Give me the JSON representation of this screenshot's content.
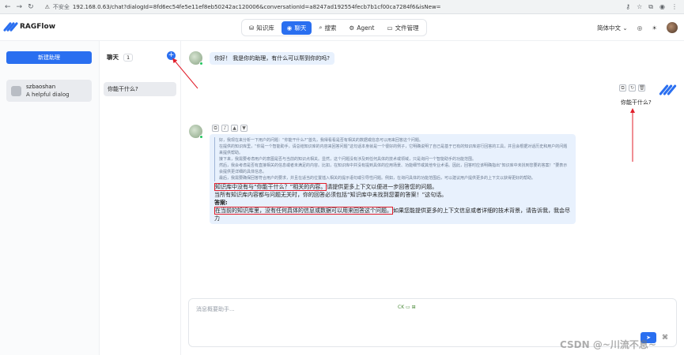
{
  "browser": {
    "insecure_label": "不安全",
    "url": "192.168.0.63/chat?dialogId=8fd6ec54fe5e11ef8eb50242ac120006&conversationId=a8247ad192554fecb7b1cf00ca7284f6&isNew="
  },
  "app": {
    "name": "RAGFlow",
    "tabs": [
      {
        "label": "知识库",
        "icon": "database-icon"
      },
      {
        "label": "聊天",
        "icon": "chat-icon"
      },
      {
        "label": "搜索",
        "icon": "search-icon"
      },
      {
        "label": "Agent",
        "icon": "agent-icon"
      },
      {
        "label": "文件管理",
        "icon": "folder-icon"
      }
    ],
    "active_tab": "聊天",
    "language": "简体中文"
  },
  "sidebar": {
    "new_button": "新建助理",
    "assistant": {
      "name": "szbaoshan",
      "desc": "A helpful dialog"
    }
  },
  "conversations": {
    "title": "聊天",
    "count": "1",
    "items": [
      "你能干什么?"
    ]
  },
  "chat": {
    "greeting": "你好！ 我是你的助理，有什么可以帮到你的吗?",
    "user_message": "你能干什么?",
    "thinking": [
      "好，我现在来分析一下用户的问题：“你能干什么?”首先，我得看看是否有相关的数据或信息可以用来回答这个问题。",
      "在提供的知识库里，“你是一个智能助手，请总结知识库的内容来回答问题”这句话本身就是一个很好的例子，它明确说明了自己是基于已有的知识库进行回答的工具，并且会根据对话历史和用户的问题来提供帮助。",
      "接下来，我需要考虑用户的意图是否与当前的知识点相关。显然，这个问题没有涉及到任何具体的技术或领域，只是询问一个智能助手的功能范围。",
      "然后，我会考虑是否有直接相关的信息或者未满足的内容。比如，在知识库中并没有提到具体的应用场景、功能细节或其他专业术语。因此，回答时应该明确指出“知识库中未找到您要的答案！”要表示会提供更详细的具体信息。",
      "最后，我需要确保回答符合用户的要求，并且在适当的位置插入相关的提示语句或引导性问题。例如，在询问具体的功能范围后，可以建议用户提供更多的上下文以获得更好的帮助。"
    ],
    "answer_lines": {
      "l1a": "知识库中没有与“你能干什么？”相关的内容。",
      "l1b": "请提供更多上下文以便进一步回答您的问题。",
      "l2": "当所有知识库内容都与问题无关时，你的回答必须包括“知识库中未找到您要的答案！”这句话。",
      "l3": "答案:",
      "l4a": "在当前的知识库里，没有任何具体的信息或数据可以用来回答这个问题。",
      "l4b": "如果您能提供更多的上下文信息或者详细的技术背景，请告诉我，我会尽力"
    },
    "input_placeholder": "消息概要助手...",
    "status_icons": "CK ▭ ⊞"
  },
  "watermark": "CSDN @~川流不息~"
}
